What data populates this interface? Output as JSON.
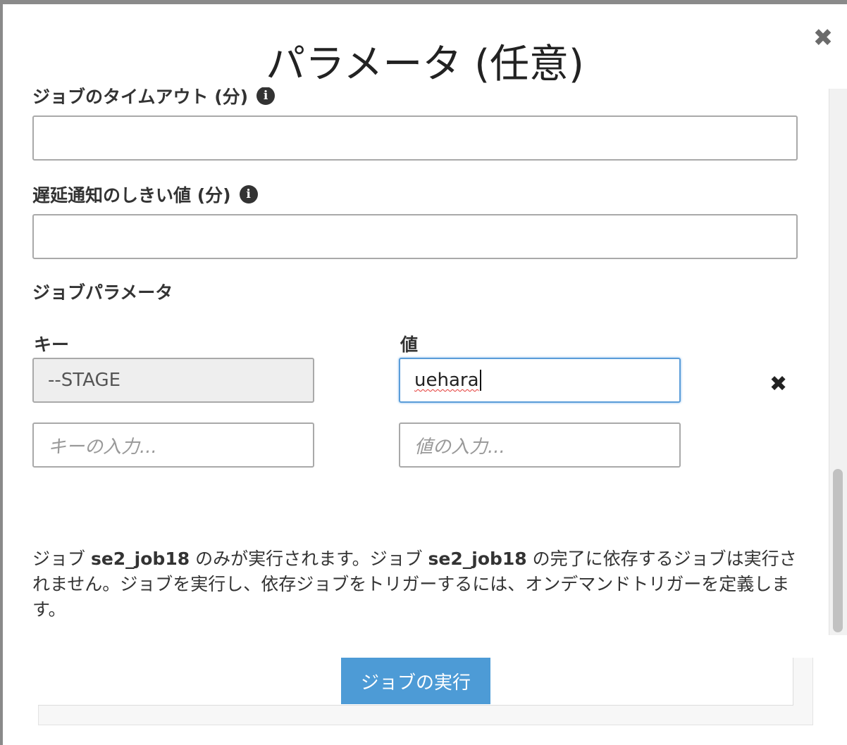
{
  "dialog": {
    "title": "パラメータ (任意)",
    "close_icon": "close-icon"
  },
  "fields": {
    "timeout_label": "ジョブのタイムアウト (分)",
    "timeout_value": "",
    "delay_label": "遅延通知のしきい値 (分)",
    "delay_value": ""
  },
  "job_params": {
    "section_title": "ジョブパラメータ",
    "key_header": "キー",
    "value_header": "値",
    "rows": [
      {
        "key": "--STAGE",
        "value": "uehara"
      }
    ],
    "key_placeholder": "キーの入力...",
    "value_placeholder": "値の入力..."
  },
  "notice": {
    "part1": "ジョブ ",
    "job1": "se2_job18",
    "part2": " のみが実行されます。ジョブ ",
    "job2": "se2_job18",
    "part3": " の完了に依存するジョブは実行されません。ジョブを実行し、依存ジョブをトリガーするには、オンデマンドトリガーを定義します。"
  },
  "actions": {
    "run_label": "ジョブの実行"
  },
  "colors": {
    "primary_button": "#4d9bd6",
    "focus_border": "#5b9dd9"
  }
}
